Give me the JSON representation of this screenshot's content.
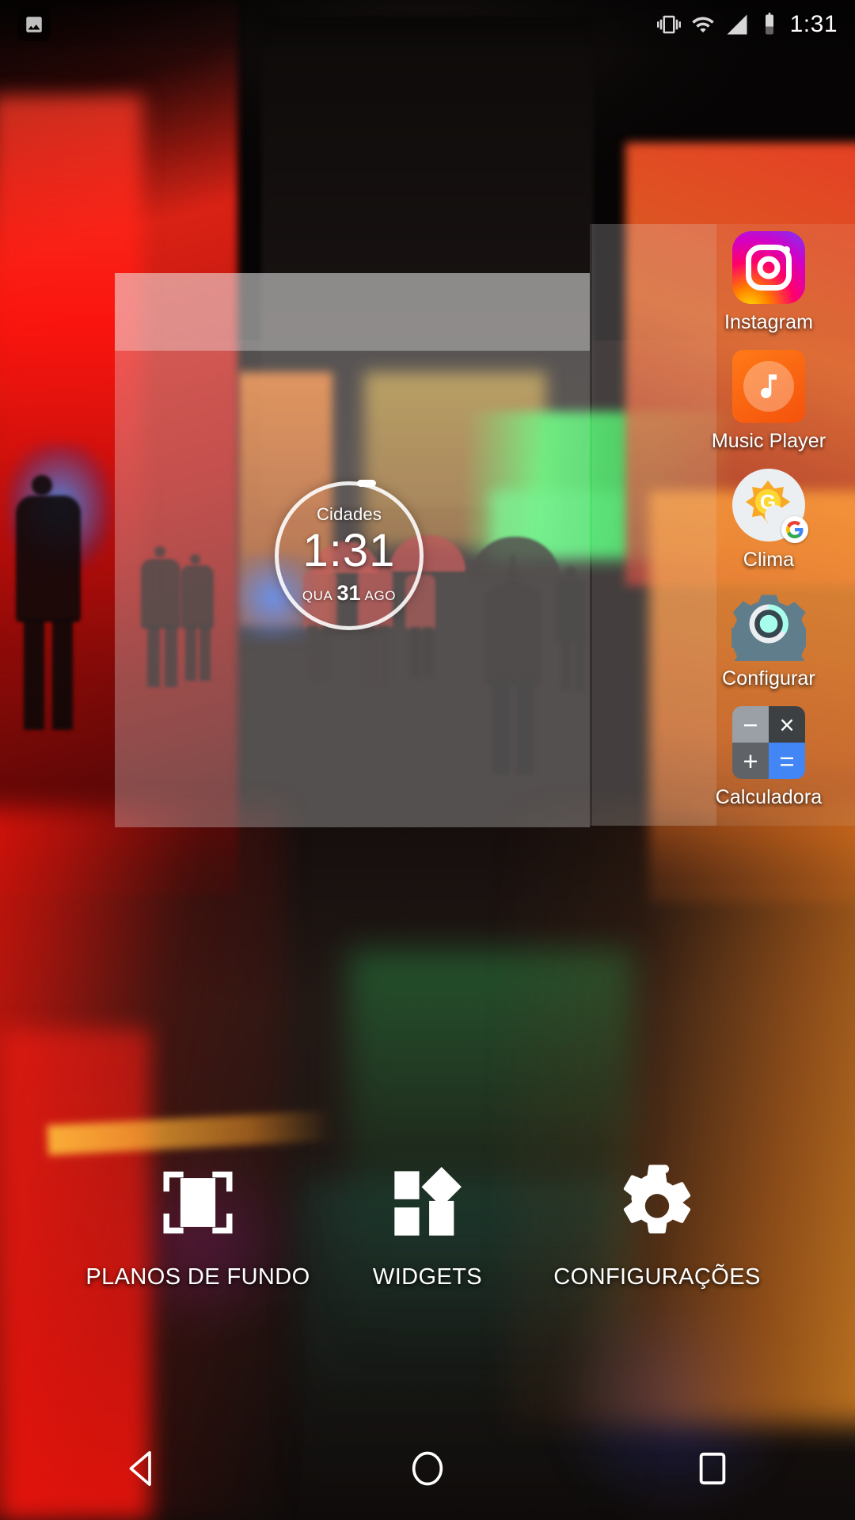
{
  "status_bar": {
    "notification_icon": "image-notification-icon",
    "icons": [
      "vibrate-icon",
      "wifi-icon",
      "signal-icon",
      "battery-icon"
    ],
    "clock": "1:31"
  },
  "clock_widget": {
    "city_label": "Cidades",
    "time": "1:31",
    "weekday": "QUA",
    "day": "31",
    "month": "AGO"
  },
  "app_dock": {
    "apps": [
      {
        "label": "Instagram",
        "icon": "instagram-icon"
      },
      {
        "label": "Music Player",
        "icon": "music-note-icon"
      },
      {
        "label": "Clima",
        "icon": "weather-sun-cloud-icon"
      },
      {
        "label": "Configurar",
        "icon": "gear-icon"
      },
      {
        "label": "Calculadora",
        "icon": "calculator-icon"
      }
    ]
  },
  "calculator_keys": {
    "minus": "−",
    "times": "×",
    "plus": "+",
    "equals": "="
  },
  "action_bar": {
    "items": [
      {
        "label": "PLANOS DE FUNDO",
        "icon": "wallpaper-icon"
      },
      {
        "label": "WIDGETS",
        "icon": "widgets-icon"
      },
      {
        "label": "CONFIGURAÇÕES",
        "icon": "settings-gear-icon"
      }
    ]
  },
  "nav_bar": {
    "back": "back-triangle-icon",
    "home": "home-circle-icon",
    "recents": "recents-square-icon"
  },
  "colors": {
    "instagram_pink": "#ff0069",
    "instagram_purple": "#7638fa",
    "instagram_yellow": "#ffd600",
    "music_orange": "#f4520b",
    "weather_yellow": "#fbbc04",
    "settings_blue_gray": "#607d8b",
    "settings_teal": "#a7ffeb",
    "calc_blue": "#4285f4",
    "calc_dark": "#3c4043",
    "calc_gray": "#9aa0a6",
    "overlay_white": "#ffffff"
  }
}
